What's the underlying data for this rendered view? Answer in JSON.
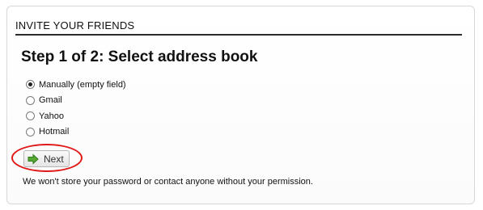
{
  "section": {
    "header": "INVITE YOUR FRIENDS"
  },
  "step_title": "Step 1 of 2: Select address book",
  "address_books": [
    {
      "label": "Manually (empty field)",
      "selected": true
    },
    {
      "label": "Gmail",
      "selected": false
    },
    {
      "label": "Yahoo",
      "selected": false
    },
    {
      "label": "Hotmail",
      "selected": false
    }
  ],
  "next_button": {
    "label": "Next",
    "icon": "right-arrow-icon",
    "icon_color": "#57a832"
  },
  "highlight": {
    "color": "#e01818"
  },
  "note": "We won't store your password or contact anyone without your permission."
}
